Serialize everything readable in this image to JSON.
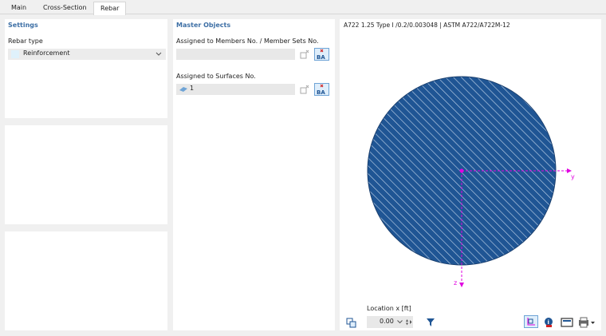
{
  "tabs": [
    {
      "label": "Main",
      "active": false
    },
    {
      "label": "Cross-Section",
      "active": false
    },
    {
      "label": "Rebar",
      "active": true
    }
  ],
  "settings": {
    "title": "Settings",
    "rebar_type_label": "Rebar type",
    "rebar_type_value": "Reinforcement"
  },
  "master_objects": {
    "title": "Master Objects",
    "members_label": "Assigned to Members No. / Member Sets No.",
    "members_value": "",
    "surfaces_label": "Assigned to Surfaces No.",
    "surfaces_value": "1"
  },
  "preview": {
    "caption": "A722 1.25 Type I /0.2/0.003048 | ASTM A722/A722M-12",
    "axis_y": "y",
    "axis_z": "z",
    "location_label": "Location x [ft]",
    "location_value": "0.00"
  },
  "colors": {
    "section_fill": "#1f5594",
    "axis": "#e000e0",
    "title_blue": "#3d6fa5"
  }
}
